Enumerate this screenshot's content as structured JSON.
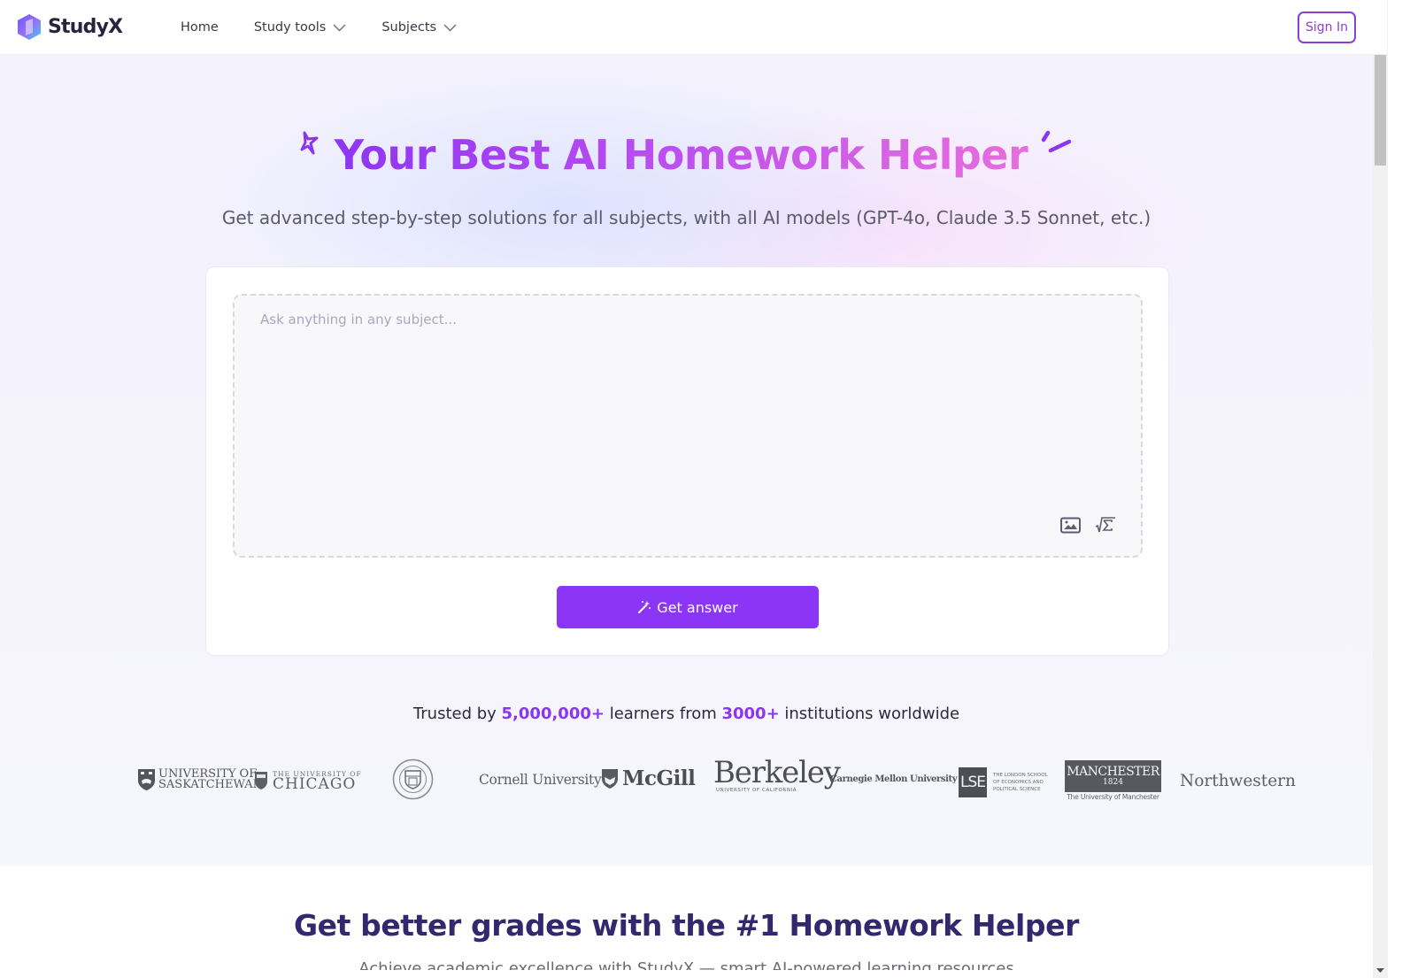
{
  "header": {
    "brand": "StudyX",
    "nav": [
      {
        "label": "Home",
        "has_dropdown": false
      },
      {
        "label": "Study tools",
        "has_dropdown": true
      },
      {
        "label": "Subjects",
        "has_dropdown": true
      }
    ],
    "sign_in_label": "Sign In"
  },
  "hero": {
    "title": "Your Best AI Homework Helper",
    "subtitle": "Get advanced step-by-step solutions for all subjects, with all AI models (GPT-4o, Claude 3.5 Sonnet, etc.)",
    "question_input": {
      "value": "",
      "placeholder": "Ask anything in any subject..."
    },
    "tools": [
      {
        "icon": "image-upload-icon",
        "label": "Upload image"
      },
      {
        "icon": "math-formula-icon",
        "label": "Insert formula"
      }
    ],
    "submit_label": "Get answer"
  },
  "trusted": {
    "prefix": "Trusted by ",
    "learners": "5,000,000+",
    "middle": " learners from ",
    "institutions": "3000+",
    "suffix": " institutions worldwide"
  },
  "institutions": {
    "saskatchewan": {
      "line1": "UNIVERSITY OF",
      "line2": "SASKATCHEWAN"
    },
    "chicago": {
      "line1": "THE UNIVERSITY OF",
      "line2": "CHICAGO"
    },
    "cornell": "Cornell University",
    "mcgill": "McGill",
    "berkeley": {
      "name": "Berkeley",
      "sub": "UNIVERSITY OF CALIFORNIA"
    },
    "cmu": "Carnegie Mellon University",
    "lse": {
      "mark": "LSE",
      "line1": "THE LONDON SCHOOL",
      "line2": "OF ECONOMICS AND",
      "line3": "POLITICAL SCIENCE"
    },
    "manchester": {
      "name": "MANCHESTER",
      "year": "1824",
      "sub": "The University of Manchester"
    },
    "northwestern": "Northwestern"
  },
  "section2": {
    "title": "Get better grades with the #1 Homework Helper",
    "subtitle": "Achieve academic excellence with StudyX — smart AI-powered learning resources"
  },
  "colors": {
    "accent": "#8b35f7",
    "title_gradient_start": "#8b35f3",
    "title_gradient_end": "#e96fdc",
    "section_title": "#33286e"
  }
}
